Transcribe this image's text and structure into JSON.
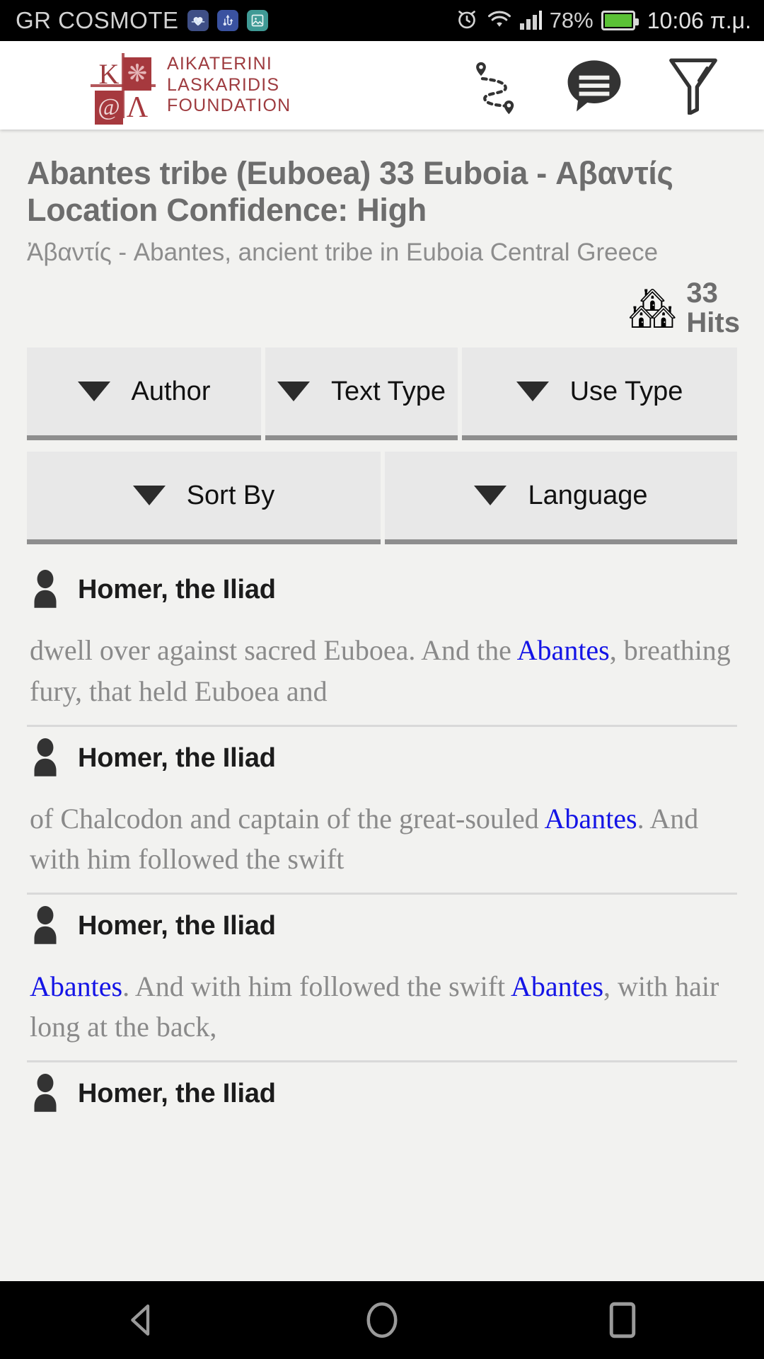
{
  "status_bar": {
    "carrier": "GR COSMOTE",
    "battery_percent": "78%",
    "time": "10:06 π.μ.",
    "icons": [
      "heart-rate-icon",
      "usb-icon",
      "gallery-icon",
      "alarm-icon",
      "wifi-icon",
      "signal-icon",
      "battery-icon"
    ]
  },
  "app_bar": {
    "logo": {
      "letter_top_left": "K",
      "letter_bottom_left": "@",
      "letter_bottom_right": "Λ"
    },
    "brand_lines": [
      "AIKATERINI",
      "LASKARIDIS",
      "FOUNDATION"
    ],
    "actions": [
      {
        "name": "route-pins-icon",
        "label": "Map route"
      },
      {
        "name": "chat-bubble-icon",
        "label": "Comments"
      },
      {
        "name": "filter-funnel-icon",
        "label": "Filter"
      }
    ]
  },
  "place": {
    "title": "Abantes tribe (Euboea) 33 Euboia - Αβαντίς Location Confidence: High",
    "subtitle": "Ἀβαντίς - Abantes, ancient tribe in Euboia Central Greece",
    "hits_count": "33",
    "hits_label": "Hits",
    "hits_icon": "🏘"
  },
  "filters": {
    "row1": [
      {
        "label": "Author"
      },
      {
        "label": "Text Type"
      },
      {
        "label": "Use Type"
      }
    ],
    "row2": [
      {
        "label": "Sort By"
      },
      {
        "label": "Language"
      }
    ]
  },
  "results": [
    {
      "author": "Homer, the Iliad",
      "snippet_parts": [
        {
          "text": "dwell over against sacred Euboea. And the ",
          "highlight": false
        },
        {
          "text": "Abantes",
          "highlight": true
        },
        {
          "text": ", breathing fury, that held Euboea and",
          "highlight": false
        }
      ]
    },
    {
      "author": "Homer, the Iliad",
      "snippet_parts": [
        {
          "text": "of Chalcodon and captain of the great-souled ",
          "highlight": false
        },
        {
          "text": "Abantes",
          "highlight": true
        },
        {
          "text": ". And with him followed the swift",
          "highlight": false
        }
      ]
    },
    {
      "author": "Homer, the Iliad",
      "snippet_parts": [
        {
          "text": "Abantes",
          "highlight": true
        },
        {
          "text": ". And with him followed the swift ",
          "highlight": false
        },
        {
          "text": "Abantes",
          "highlight": true
        },
        {
          "text": ", with hair long at the back,",
          "highlight": false
        }
      ]
    },
    {
      "author": "Homer, the Iliad",
      "snippet_parts": []
    }
  ],
  "nav_bar": {
    "buttons": [
      {
        "name": "back-button"
      },
      {
        "name": "home-button"
      },
      {
        "name": "recents-button"
      }
    ]
  },
  "colors": {
    "brand_red": "#a6393e",
    "link_blue": "#1414e6",
    "background": "#f2f2f0",
    "spinner_bg": "#e8e8e8",
    "title_grey": "#6d6d6d"
  }
}
